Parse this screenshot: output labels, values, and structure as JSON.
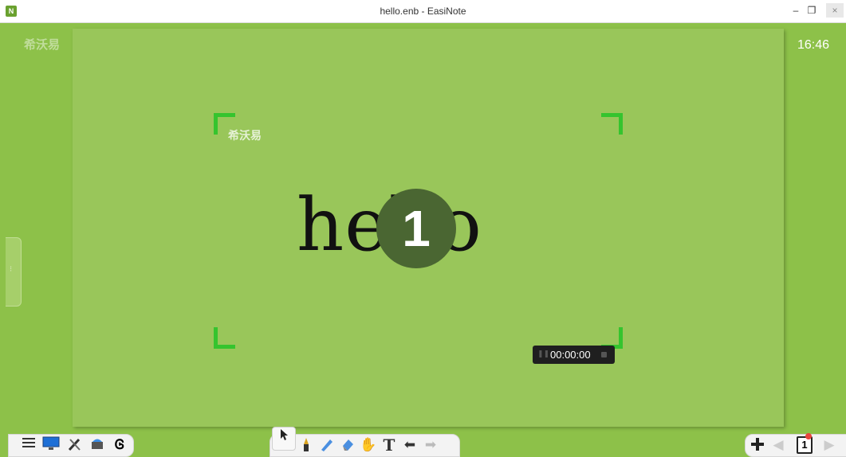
{
  "window": {
    "title": "hello.enb - EasiNote",
    "app_icon_glyph": "N",
    "min_glyph": "–",
    "max_glyph": "❐",
    "close_glyph": "×"
  },
  "board": {
    "logo_text": "希沃易",
    "clock": "16:46",
    "content_text": "hello",
    "countdown": "1",
    "timer": "00:00:00",
    "background_color": "#99c65a",
    "frame_color": "#35c42e"
  },
  "toolbar_left": {
    "icons": [
      "menu-icon",
      "screen-icon",
      "tools-icon",
      "cloud-icon",
      "text-recognition-icon"
    ]
  },
  "toolbar_center": {
    "icons": [
      "select-icon",
      "pen-icon",
      "brush-icon",
      "eraser-icon",
      "hand-icon",
      "text-icon",
      "undo-icon",
      "redo-icon"
    ],
    "text_tool_glyph": "T"
  },
  "toolbar_right": {
    "icons": [
      "add-page-icon",
      "prev-page-icon",
      "page-icon",
      "next-page-icon"
    ],
    "page_number": "1"
  }
}
